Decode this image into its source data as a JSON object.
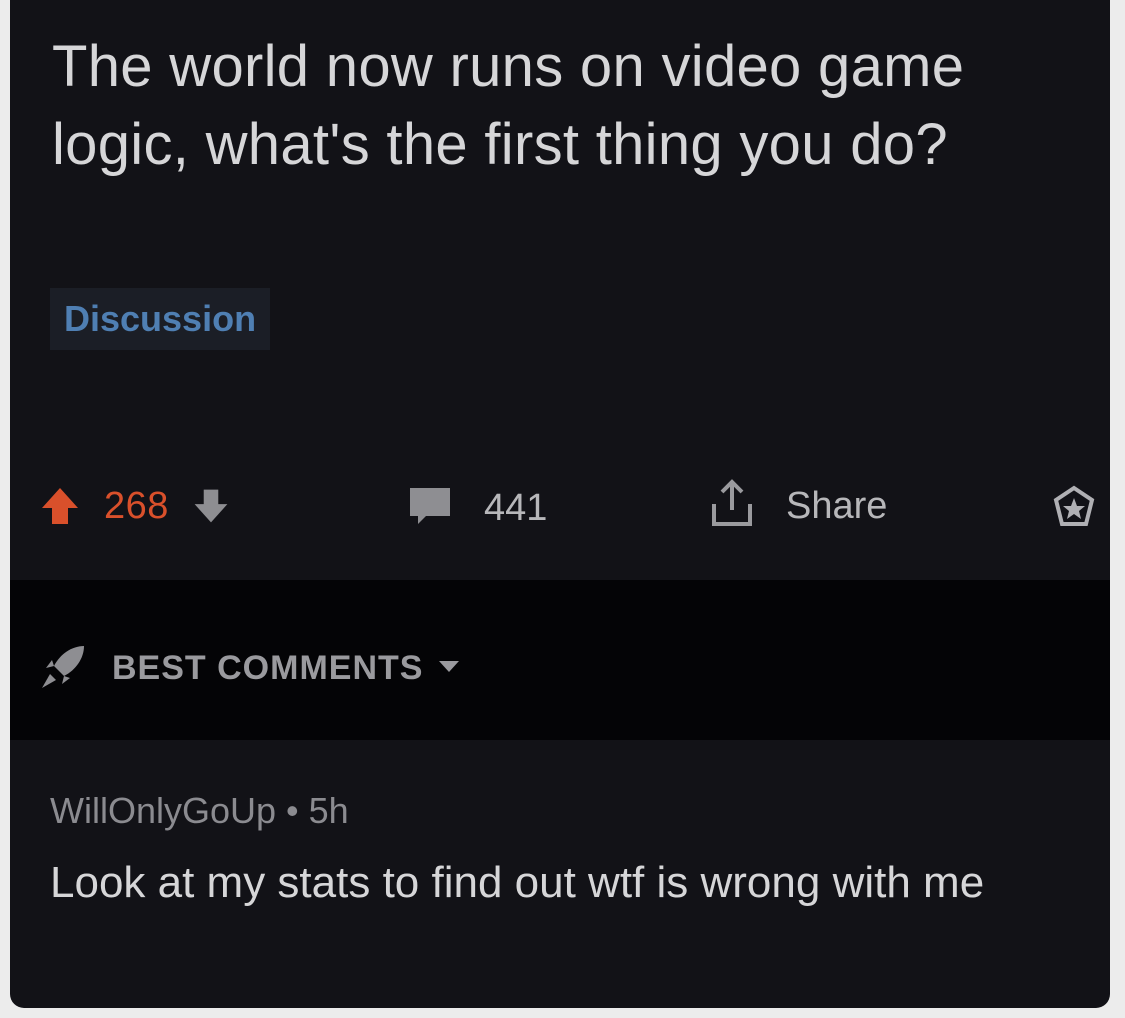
{
  "post": {
    "title": "The world now runs on video game logic, what's the first thing you do?",
    "flair": "Discussion",
    "score": "268",
    "comment_count": "441",
    "share_label": "Share"
  },
  "sort": {
    "label": "BEST COMMENTS"
  },
  "comment": {
    "author": "WillOnlyGoUp",
    "separator": "•",
    "age": "5h",
    "body": "Look at my stats to find out wtf is wrong with me"
  },
  "colors": {
    "background": "#121217",
    "upvote": "#d9502b",
    "flair_text": "#4f7fb3"
  },
  "icons": {
    "upvote": "upvote-arrow-icon",
    "downvote": "downvote-arrow-icon",
    "comments": "speech-bubble-icon",
    "share": "share-icon",
    "award": "award-icon",
    "sort": "rocket-icon",
    "caret": "caret-down-icon"
  }
}
